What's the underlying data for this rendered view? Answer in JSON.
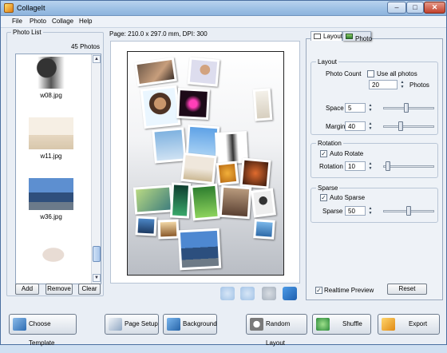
{
  "window": {
    "title": "CollageIt",
    "min": "–",
    "max": "□",
    "close": "✕"
  },
  "menu": [
    "File",
    "Photo",
    "Collage",
    "Help"
  ],
  "photo_list": {
    "title": "Photo List",
    "count": "45 Photos",
    "items": [
      {
        "name": "w08.jpg",
        "icon": "photo-silhouette"
      },
      {
        "name": "w11.jpg",
        "icon": "photo-yoga"
      },
      {
        "name": "w36.jpg",
        "icon": "photo-city"
      },
      {
        "name": "",
        "icon": "photo-face"
      }
    ],
    "add": "Add",
    "remove": "Remove",
    "clear": "Clear"
  },
  "page_info": "Page: 210.0 x 297.0 mm, DPI: 300",
  "tabs": {
    "layout": "Layout",
    "photo": "Photo"
  },
  "layout": {
    "group_title": "Layout",
    "photo_count_label": "Photo Count",
    "use_all_label": "Use all photos",
    "use_all_checked": false,
    "photo_count_value": "20",
    "photos_label": "Photos",
    "space_label": "Space",
    "space_value": "5",
    "space_level": 0.45,
    "margin_label": "Margin",
    "margin_value": "40",
    "margin_level": 0.35
  },
  "rotation": {
    "group_title": "Rotation",
    "auto_label": "Auto Rotate",
    "auto_checked": true,
    "rotation_label": "Rotation",
    "rotation_value": "10",
    "rotation_level": 0.1
  },
  "sparse": {
    "group_title": "Sparse",
    "auto_label": "Auto Sparse",
    "auto_checked": true,
    "sparse_label": "Sparse",
    "sparse_value": "50",
    "sparse_level": 0.5
  },
  "realtime_preview_label": "Realtime Preview",
  "realtime_checked": true,
  "reset": "Reset",
  "bottom": {
    "choose_template": "Choose Template",
    "page_setup": "Page Setup",
    "background": "Background",
    "random_layout": "Random Layout",
    "shuffle": "Shuffle",
    "export": "Export"
  },
  "colors": {
    "accent": "#3c78c8",
    "titlebar": "#9bbfe4"
  }
}
